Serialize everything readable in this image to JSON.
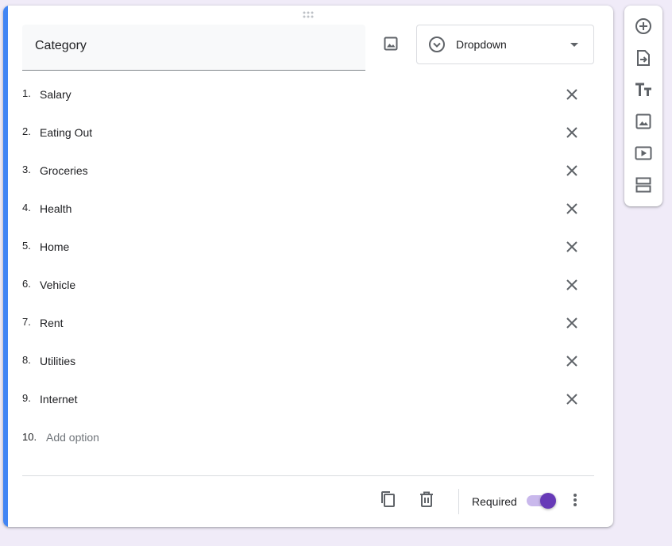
{
  "question": {
    "title": "Category",
    "type_label": "Dropdown",
    "options": [
      {
        "num": "1.",
        "label": "Salary"
      },
      {
        "num": "2.",
        "label": "Eating Out"
      },
      {
        "num": "3.",
        "label": "Groceries"
      },
      {
        "num": "4.",
        "label": "Health"
      },
      {
        "num": "5.",
        "label": "Home"
      },
      {
        "num": "6.",
        "label": "Vehicle"
      },
      {
        "num": "7.",
        "label": "Rent"
      },
      {
        "num": "8.",
        "label": "Utilities"
      },
      {
        "num": "9.",
        "label": "Internet"
      }
    ],
    "add_option": {
      "num": "10.",
      "label": "Add option"
    },
    "required_label": "Required",
    "required_on": true
  },
  "colors": {
    "accent": "#4285f4",
    "toggle_on": "#673ab7",
    "background": "#f0ebf8"
  },
  "icons": {
    "drag": "drag-handle-icon",
    "image": "image-icon",
    "type": "dropdown-circle-icon",
    "remove": "close-icon",
    "copy": "duplicate-icon",
    "delete": "trash-icon",
    "more": "more-vert-icon",
    "toolbar": [
      "add-circle-icon",
      "import-icon",
      "title-icon",
      "image-icon",
      "video-icon",
      "section-icon"
    ]
  }
}
